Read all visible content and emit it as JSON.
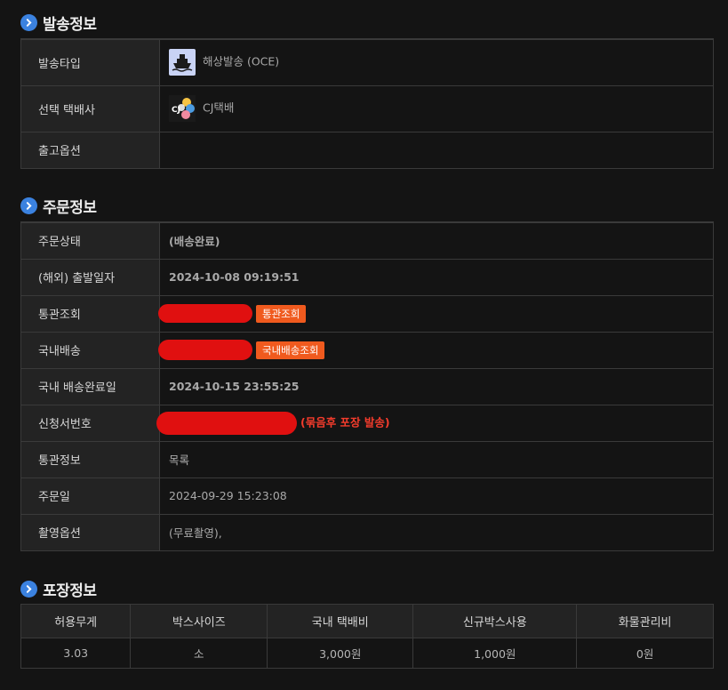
{
  "shipping_info": {
    "title": "발송정보",
    "rows": [
      {
        "label": "발송타입",
        "value": "해상발송 (OCE)",
        "icon": "ship-icon"
      },
      {
        "label": "선택 택배사",
        "value": "CJ택배",
        "icon": "cj-logo"
      },
      {
        "label": "출고옵션",
        "value": ""
      }
    ]
  },
  "order_info": {
    "title": "주문정보",
    "status_label": "주문상태",
    "status_value": "(배송완료)",
    "departure_label": "(해외) 출발일자",
    "departure_value": "2024-10-08 09:19:51",
    "customs_label": "통관조회",
    "customs_button": "통관조회",
    "domestic_label": "국내배송",
    "domestic_button": "국내배송조회",
    "domestic_done_label": "국내 배송완료일",
    "domestic_done_value": "2024-10-15 23:55:25",
    "application_label": "신청서번호",
    "application_note": "(묶음후 포장 발송)",
    "customs_info_label": "통관정보",
    "customs_info_value": "목록",
    "order_date_label": "주문일",
    "order_date_value": "2024-09-29 15:23:08",
    "photo_option_label": "촬영옵션",
    "photo_option_value": "(무료촬영),"
  },
  "packing_info": {
    "title": "포장정보",
    "headers": [
      "허용무게",
      "박스사이즈",
      "국내 택배비",
      "신규박스사용",
      "화물관리비"
    ],
    "values": [
      "3.03",
      "소",
      "3,000원",
      "1,000원",
      "0원"
    ]
  },
  "colors": {
    "background": "#141414",
    "label_bg": "#232323",
    "border": "#3a3a3a",
    "accent_blue": "#3b82e0",
    "status_red": "#f43c2c",
    "date_blue": "#5c97e8",
    "button_orange": "#f05a1e",
    "redaction_red": "#e01010"
  }
}
